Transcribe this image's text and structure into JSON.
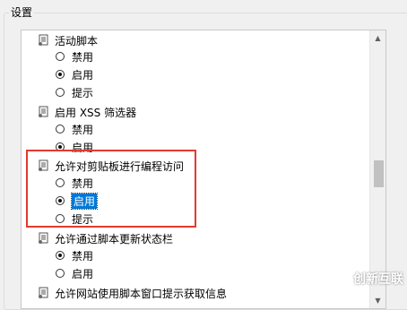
{
  "group": {
    "label": "设置"
  },
  "settings": [
    {
      "name": "活动脚本",
      "options": [
        "禁用",
        "启用",
        "提示"
      ]
    },
    {
      "name": "启用 XSS 筛选器",
      "options": [
        "禁用",
        "启用"
      ]
    },
    {
      "name": "允许对剪贴板进行编程访问",
      "options": [
        "禁用",
        "启用",
        "提示"
      ]
    },
    {
      "name": "允许通过脚本更新状态栏",
      "options": [
        "禁用",
        "启用"
      ]
    },
    {
      "name": "允许网站使用脚本窗口提示获取信息"
    }
  ],
  "watermark": {
    "text": "创新互联"
  },
  "colors": {
    "highlight": "#e23a2e",
    "selection": "#0078d7"
  }
}
